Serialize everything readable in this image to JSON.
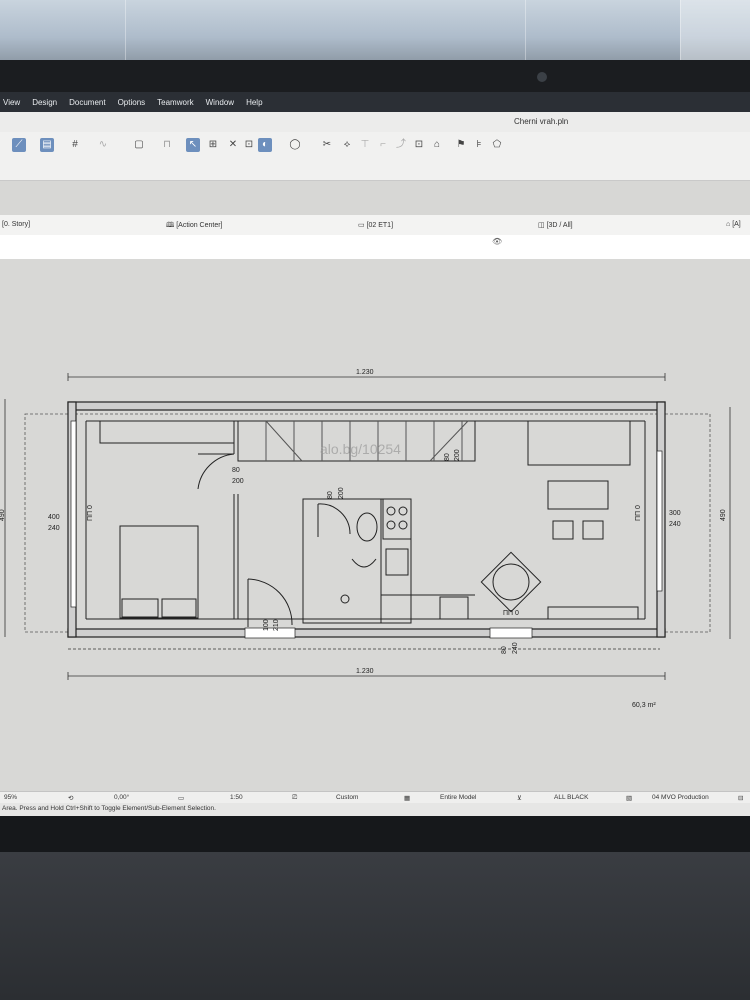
{
  "menu": {
    "items": [
      "View",
      "Design",
      "Document",
      "Options",
      "Teamwork",
      "Window",
      "Help"
    ]
  },
  "document": {
    "title": "Cherni vrah.pln"
  },
  "tabs": {
    "story": "[0. Story]",
    "action_center": "[Action Center]",
    "layout": "[02 ET1]",
    "view3d": "[3D / All]",
    "other": "[A]"
  },
  "plan": {
    "total_width_top": "1.230",
    "total_width_bottom": "1.230",
    "left_opening_top": "400",
    "left_opening_bottom": "240",
    "left_window_code": "ПП 0",
    "right_opening_top": "300",
    "right_opening_bottom": "240",
    "right_window_code": "ПП 0",
    "bottom_window_code": "ПП 0",
    "door_bedroom_top": "80",
    "door_bedroom_bottom": "200",
    "door_bath_top": "80",
    "door_bath_bottom": "200",
    "door_entry_left": "100",
    "door_entry_right": "210",
    "stair_top": "80",
    "stair_bottom": "200",
    "bottom_opening_top": "80",
    "bottom_opening_bottom": "240",
    "left_height": "490",
    "right_height": "490",
    "area": "60,3 m²",
    "watermark": "alo.bg/10254"
  },
  "status": {
    "zoom": "95%",
    "angle": "0,00°",
    "scale": "1:50",
    "pen": "Custom",
    "filter": "Entire Model",
    "color": "ALL BLACK",
    "set": "04 MVO Production"
  },
  "hint": "Area. Press and Hold Ctrl+Shift to Toggle Element/Sub-Element Selection."
}
